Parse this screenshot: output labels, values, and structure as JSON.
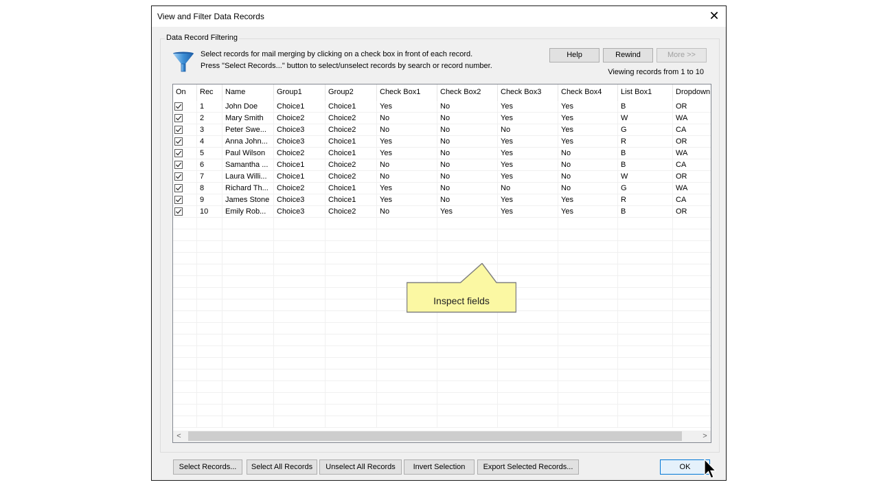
{
  "window": {
    "title": "View and Filter Data Records",
    "close_label": "✕"
  },
  "group": {
    "label": "Data Record Filtering",
    "icon": "funnel-icon",
    "instructions": [
      "Select records for mail merging by clicking on a check box in front of each record.",
      "Press \"Select Records...\" button to select/unselect records by search or record number."
    ],
    "buttons": {
      "help": "Help",
      "rewind": "Rewind",
      "more": "More >>"
    },
    "viewing_text": "Viewing records from 1 to 10"
  },
  "table": {
    "columns": [
      "On",
      "Rec",
      "Name",
      "Group1",
      "Group2",
      "Check Box1",
      "Check Box2",
      "Check Box3",
      "Check Box4",
      "List Box1",
      "Dropdown"
    ],
    "rows": [
      {
        "on": true,
        "rec": "1",
        "name": "John Doe",
        "group1": "Choice1",
        "group2": "Choice1",
        "cb1": "Yes",
        "cb2": "No",
        "cb3": "Yes",
        "cb4": "Yes",
        "list1": "B",
        "dropdown": "OR"
      },
      {
        "on": true,
        "rec": "2",
        "name": "Mary Smith",
        "group1": "Choice2",
        "group2": "Choice2",
        "cb1": "No",
        "cb2": "No",
        "cb3": "Yes",
        "cb4": "Yes",
        "list1": "W",
        "dropdown": "WA"
      },
      {
        "on": true,
        "rec": "3",
        "name": "Peter Swe...",
        "group1": "Choice3",
        "group2": "Choice2",
        "cb1": "No",
        "cb2": "No",
        "cb3": "No",
        "cb4": "Yes",
        "list1": "G",
        "dropdown": "CA"
      },
      {
        "on": true,
        "rec": "4",
        "name": "Anna John...",
        "group1": "Choice3",
        "group2": "Choice1",
        "cb1": "Yes",
        "cb2": "No",
        "cb3": "Yes",
        "cb4": "Yes",
        "list1": "R",
        "dropdown": "OR"
      },
      {
        "on": true,
        "rec": "5",
        "name": "Paul Wilson",
        "group1": "Choice2",
        "group2": "Choice1",
        "cb1": "Yes",
        "cb2": "No",
        "cb3": "Yes",
        "cb4": "No",
        "list1": "B",
        "dropdown": "WA"
      },
      {
        "on": true,
        "rec": "6",
        "name": "Samantha ...",
        "group1": "Choice1",
        "group2": "Choice2",
        "cb1": "No",
        "cb2": "No",
        "cb3": "Yes",
        "cb4": "No",
        "list1": "B",
        "dropdown": "CA"
      },
      {
        "on": true,
        "rec": "7",
        "name": "Laura Willi...",
        "group1": "Choice1",
        "group2": "Choice2",
        "cb1": "No",
        "cb2": "No",
        "cb3": "Yes",
        "cb4": "No",
        "list1": "W",
        "dropdown": "OR"
      },
      {
        "on": true,
        "rec": "8",
        "name": "Richard Th...",
        "group1": "Choice2",
        "group2": "Choice1",
        "cb1": "Yes",
        "cb2": "No",
        "cb3": "No",
        "cb4": "No",
        "list1": "G",
        "dropdown": "WA"
      },
      {
        "on": true,
        "rec": "9",
        "name": "James Stone",
        "group1": "Choice3",
        "group2": "Choice1",
        "cb1": "Yes",
        "cb2": "No",
        "cb3": "Yes",
        "cb4": "Yes",
        "list1": "R",
        "dropdown": "CA"
      },
      {
        "on": true,
        "rec": "10",
        "name": "Emily Rob...",
        "group1": "Choice3",
        "group2": "Choice2",
        "cb1": "No",
        "cb2": "Yes",
        "cb3": "Yes",
        "cb4": "Yes",
        "list1": "B",
        "dropdown": "OR"
      }
    ],
    "scroll_left": "<",
    "scroll_right": ">"
  },
  "callout": {
    "text": "Inspect fields",
    "fill": "#fbf8a3",
    "border": "#808080"
  },
  "footer": {
    "select_records": "Select Records...",
    "select_all": "Select All Records",
    "unselect_all": "Unselect All Records",
    "invert": "Invert Selection",
    "export": "Export Selected Records...",
    "ok": "OK"
  },
  "colors": {
    "accent": "#0078d7",
    "funnel": "#3d8fd6"
  }
}
